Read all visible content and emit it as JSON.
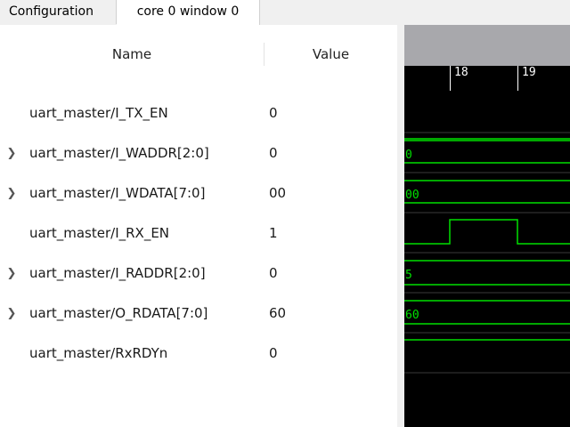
{
  "tabs": [
    {
      "label": "Configuration",
      "active": false
    },
    {
      "label": "core 0 window 0",
      "active": true
    }
  ],
  "columns": {
    "name": "Name",
    "value": "Value"
  },
  "signals": [
    {
      "name": "uart_master/I_TX_EN",
      "value": "0",
      "expandable": false
    },
    {
      "name": "uart_master/I_WADDR[2:0]",
      "value": "0",
      "expandable": true
    },
    {
      "name": "uart_master/I_WDATA[7:0]",
      "value": "00",
      "expandable": true
    },
    {
      "name": "uart_master/I_RX_EN",
      "value": "1",
      "expandable": false
    },
    {
      "name": "uart_master/I_RADDR[2:0]",
      "value": "0",
      "expandable": true
    },
    {
      "name": "uart_master/O_RDATA[7:0]",
      "value": "60",
      "expandable": true
    },
    {
      "name": "uart_master/RxRDYn",
      "value": "0",
      "expandable": false
    }
  ],
  "ruler": {
    "ticks": [
      "18",
      "19"
    ]
  },
  "waveform": {
    "bus_labels": {
      "waddr": "0",
      "wdata": "00",
      "raddr": "5",
      "rdata": "60"
    },
    "colors": {
      "signal": "#00e000",
      "background": "#000000",
      "grid": "#3a3a3a"
    }
  },
  "icons": {
    "expand": "chevron-right-icon"
  }
}
